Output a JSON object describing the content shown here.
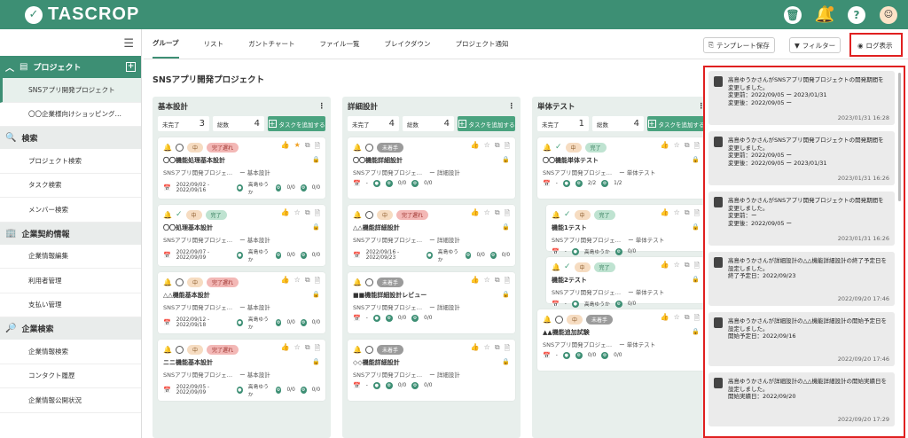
{
  "app": {
    "logo": "TASCROP"
  },
  "sidebar": {
    "project_section": "プロジェクト",
    "projects": [
      "SNSアプリ開発プロジェクト",
      "〇〇企業様向けショッピング…"
    ],
    "search_section": "検索",
    "search_items": [
      "プロジェクト検索",
      "タスク検索",
      "メンバー検索"
    ],
    "company_section": "企業契約情報",
    "company_items": [
      "企業情報編集",
      "利用者管理",
      "支払い管理"
    ],
    "csearch_section": "企業検索",
    "csearch_items": [
      "企業情報検索",
      "コンタクト履歴",
      "企業情報公開状況"
    ]
  },
  "tabs": [
    "グループ",
    "リスト",
    "ガントチャート",
    "ファイル一覧",
    "ブレイクダウン",
    "プロジェクト通知"
  ],
  "toolbar": {
    "template": "テンプレート保存",
    "filter": "フィルター",
    "log": "ログ表示"
  },
  "project_title": "SNSアプリ開発プロジェクト",
  "columns": [
    {
      "name": "基本設計",
      "incomplete_label": "未完了",
      "incomplete": "3",
      "total_label": "総数",
      "total": "4",
      "add": "タスクを追加する",
      "cards": [
        {
          "priority": "中",
          "status": "完了遅れ",
          "status_kind": "late",
          "title": "〇〇機能処理基本設計",
          "project": "SNSアプリ開発プロジェ…",
          "phase": "基本設計",
          "date": "2022/09/02 - 2022/09/16",
          "user": "高島ゆうか",
          "c1": "0/0",
          "c2": "0/0",
          "starred": true
        },
        {
          "priority": "中",
          "status": "完了",
          "status_kind": "done",
          "title": "〇〇処理基本設計",
          "project": "SNSアプリ開発プロジェ…",
          "phase": "基本設計",
          "date": "2022/09/07 - 2022/09/09",
          "user": "高島ゆうか",
          "c1": "0/0",
          "c2": "0/0"
        },
        {
          "priority": "中",
          "status": "完了遅れ",
          "status_kind": "late",
          "title": "△△機能基本設計",
          "project": "SNSアプリ開発プロジェ…",
          "phase": "基本設計",
          "date": "2022/09/12 - 2022/09/18",
          "user": "高島ゆうか",
          "c1": "0/0",
          "c2": "0/0"
        },
        {
          "priority": "中",
          "status": "完了遅れ",
          "status_kind": "late",
          "title": "ニニ機能基本設計",
          "project": "SNSアプリ開発プロジェ…",
          "phase": "基本設計",
          "date": "2022/09/05 - 2022/09/09",
          "user": "高島ゆうか",
          "c1": "0/0",
          "c2": "0/0"
        }
      ]
    },
    {
      "name": "詳細設計",
      "incomplete_label": "未完了",
      "incomplete": "4",
      "total_label": "総数",
      "total": "4",
      "add": "タスクを追加する",
      "cards": [
        {
          "priority": "",
          "status": "未着手",
          "status_kind": "todo",
          "title": "〇〇機能詳細設計",
          "project": "SNSアプリ開発プロジェ…",
          "phase": "詳細設計",
          "date": "-",
          "user": "",
          "c1": "0/0",
          "c2": "0/0"
        },
        {
          "priority": "中",
          "status": "完了遅れ",
          "status_kind": "late",
          "title": "△△機能詳細設計",
          "project": "SNSアプリ開発プロジェ…",
          "phase": "詳細設計",
          "date": "2022/09/16 - 2022/09/23",
          "user": "高島ゆうか",
          "c1": "0/0",
          "c2": "0/0"
        },
        {
          "priority": "",
          "status": "未着手",
          "status_kind": "todo",
          "title": "■■機能詳細設計レビュー",
          "project": "SNSアプリ開発プロジェ…",
          "phase": "詳細設計",
          "date": "-",
          "user": "",
          "c1": "0/0",
          "c2": "0/0"
        },
        {
          "priority": "",
          "status": "未着手",
          "status_kind": "todo",
          "title": "◇◇機能詳細設計",
          "project": "SNSアプリ開発プロジェ…",
          "phase": "詳細設計",
          "date": "-",
          "user": "",
          "c1": "0/0",
          "c2": "0/0"
        }
      ]
    },
    {
      "name": "単体テスト",
      "incomplete_label": "未完了",
      "incomplete": "1",
      "total_label": "総数",
      "total": "4",
      "add": "タスクを追加する",
      "cards": [
        {
          "priority": "中",
          "status": "完了",
          "status_kind": "done",
          "title": "〇〇機能単体テスト",
          "project": "SNSアプリ開発プロジェ…",
          "phase": "単体テスト",
          "date": "-",
          "user": "",
          "c1": "2/2",
          "c2": "1/2"
        },
        {
          "priority": "中",
          "status": "完了",
          "status_kind": "done",
          "title": "機能1テスト",
          "project": "SNSアプリ開発プロジェ…",
          "phase": "単体テスト",
          "date": "-",
          "user": "高島ゆうか",
          "c1": "",
          "c2": "0/0",
          "sub": true
        },
        {
          "priority": "中",
          "status": "完了",
          "status_kind": "done",
          "title": "機能2テスト",
          "project": "SNSアプリ開発プロジェ…",
          "phase": "単体テスト",
          "date": "-",
          "user": "高島ゆうか",
          "c1": "",
          "c2": "0/0",
          "sub": true
        },
        {
          "priority": "中",
          "status": "未着手",
          "status_kind": "todo",
          "title": "▲▲機能追加試験",
          "project": "SNSアプリ開発プロジェ…",
          "phase": "単体テスト",
          "date": "-",
          "user": "",
          "c1": "0/0",
          "c2": "0/0"
        }
      ]
    }
  ],
  "logs": [
    {
      "text": "高島ゆうかさんがSNSアプリ開発プロジェクトの開発期間を変更しました。\n変更前：2022/09/05 ー 2023/01/31\n変更後：2022/09/05 ー",
      "time": "2023/01/31 16:28"
    },
    {
      "text": "高島ゆうかさんがSNSアプリ開発プロジェクトの開発期間を変更しました。\n変更前：2022/09/05 ー\n変更後：2022/09/05 ー 2023/01/31",
      "time": "2023/01/31 16:26"
    },
    {
      "text": "高島ゆうかさんがSNSアプリ開発プロジェクトの開発期間を変更しました。\n変更前：ー\n変更後：2022/09/05 ー",
      "time": "2023/01/31 16:26"
    },
    {
      "text": "高島ゆうかさんが詳細設計の△△機能詳細設計の終了予定日を設定しました。\n終了予定日：2022/09/23",
      "time": "2022/09/20 17:46"
    },
    {
      "text": "高島ゆうかさんが詳細設計の△△機能詳細設計の開始予定日を設定しました。\n開始予定日：2022/09/16",
      "time": "2022/09/20 17:46"
    },
    {
      "text": "高島ゆうかさんが詳細設計の△△機能詳細設計の開始実績日を設定しました。\n開始実績日：2022/09/20",
      "time": "2022/09/20 17:29"
    }
  ]
}
